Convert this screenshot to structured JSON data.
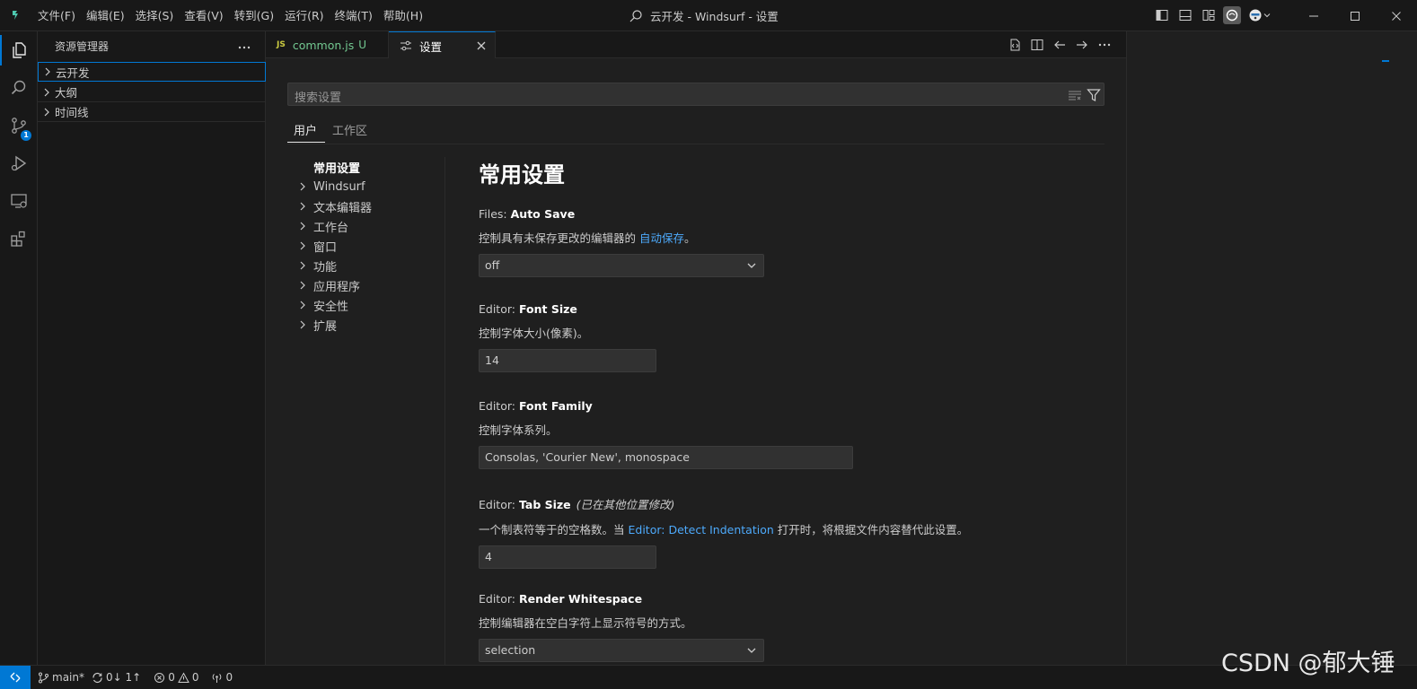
{
  "menu": [
    "文件(F)",
    "编辑(E)",
    "选择(S)",
    "查看(V)",
    "转到(G)",
    "运行(R)",
    "终端(T)",
    "帮助(H)"
  ],
  "title": "云开发 - Windsurf - 设置",
  "sidebar": {
    "title": "资源管理器",
    "sections": [
      "云开发",
      "大纲",
      "时间线"
    ]
  },
  "activity": {
    "scm_badge": "1"
  },
  "tabs": [
    {
      "icon": "JS",
      "label": "common.js",
      "status": "U"
    },
    {
      "label": "设置"
    }
  ],
  "settings": {
    "search_placeholder": "搜索设置",
    "scope_tabs": [
      "用户",
      "工作区"
    ],
    "toc_title": "常用设置",
    "toc": [
      "Windsurf",
      "文本编辑器",
      "工作台",
      "窗口",
      "功能",
      "应用程序",
      "安全性",
      "扩展"
    ],
    "section_title": "常用设置",
    "items": [
      {
        "category": "Files: ",
        "name": "Auto Save",
        "desc": "控制具有未保存更改的编辑器的 ",
        "link": "自动保存",
        "desc_after": "。",
        "value": "off"
      },
      {
        "category": "Editor: ",
        "name": "Font Size",
        "desc": "控制字体大小(像素)。",
        "value": "14"
      },
      {
        "category": "Editor: ",
        "name": "Font Family",
        "desc": "控制字体系列。",
        "value": "Consolas, 'Courier New', monospace"
      },
      {
        "category": "Editor: ",
        "name": "Tab Size",
        "modified": "(已在其他位置修改)",
        "desc": "一个制表符等于的空格数。当 ",
        "link": "Editor: Detect Indentation",
        "desc_after": " 打开时，将根据文件内容替代此设置。",
        "value": "4"
      },
      {
        "category": "Editor: ",
        "name": "Render Whitespace",
        "desc": "控制编辑器在空白字符上显示符号的方式。",
        "value": "selection"
      }
    ]
  },
  "status": {
    "branch": "main*",
    "sync": "0↓ 1↑",
    "errors": "0",
    "warnings": "0",
    "ports": "0"
  },
  "watermark": "CSDN @郁大锤",
  "colors": {
    "accent": "#0078d4",
    "link": "#4daafc",
    "untracked": "#73c991"
  }
}
